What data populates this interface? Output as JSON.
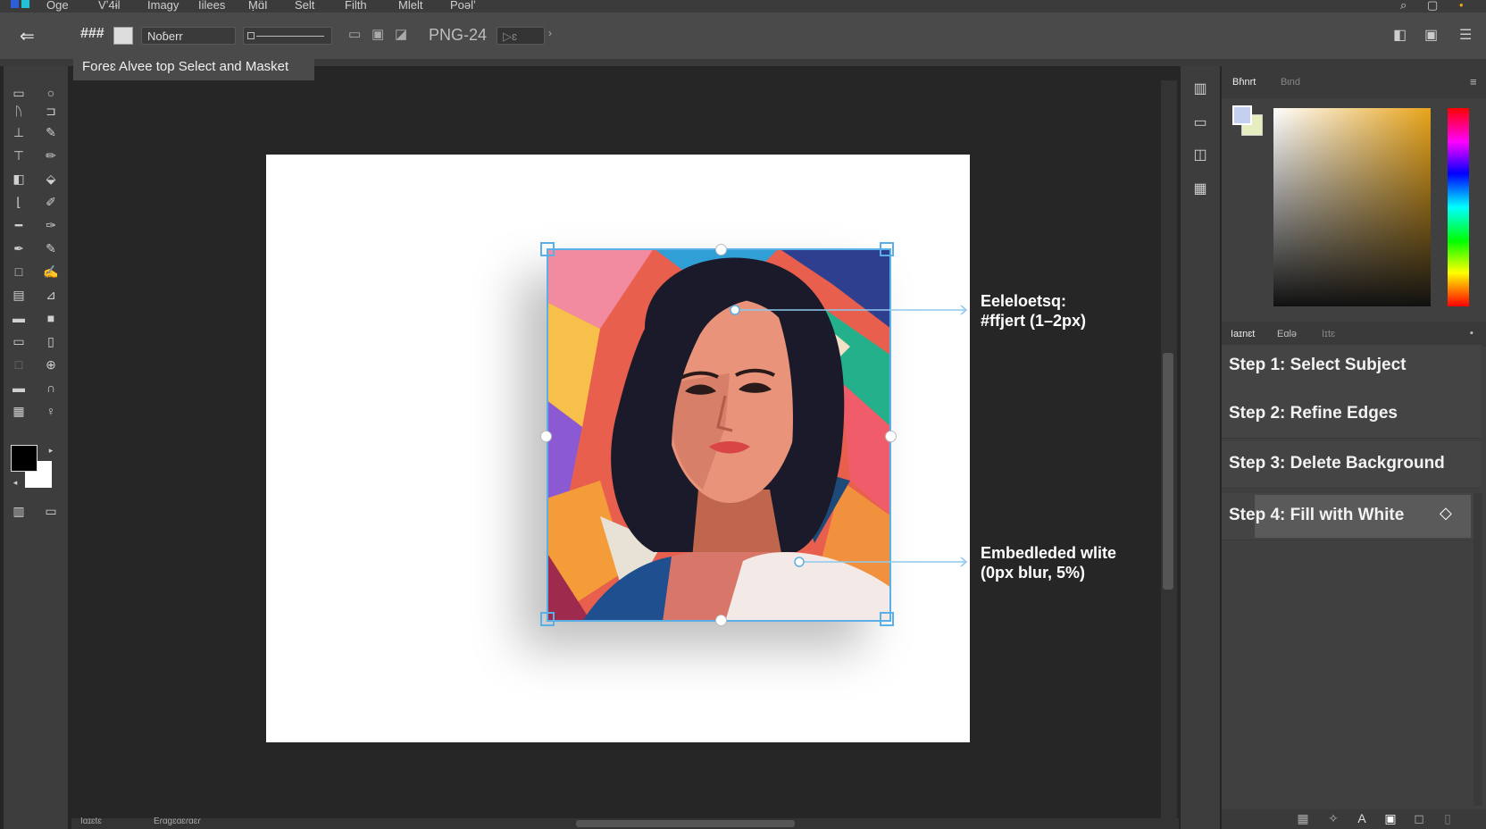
{
  "menu": {
    "items": [
      "Oɡe",
      "Vʼ4ɨl",
      "Imagy",
      "Iilees",
      "Ṃɑ̈I",
      "Selt",
      "Filth",
      "Mlelt",
      "Poəlʼ"
    ]
  },
  "options_bar": {
    "grid_icon_label": "###",
    "preset_value": "Noɓerr",
    "format_label": "PNG-24",
    "small_field_label": "▷ɛ"
  },
  "document_tab": {
    "title": "Foɾeɛ Alvee top Select and Masket"
  },
  "annotations": {
    "top_line1": "Eeleloetsq:",
    "top_line2": "#ffjert (1–2px)",
    "bottom_line1": "Embedleded wlite",
    "bottom_line2": "(0px blur, 5%)"
  },
  "color_panel": {
    "tabs": [
      "Bɦnrt",
      "Bɩnd"
    ],
    "foreground": "#000000",
    "background": "#ffffff",
    "accent": "#e8a41a"
  },
  "steps_panel": {
    "tabs": [
      "Iaɪnɛt",
      "Eɑlə",
      "Iɪtɛ"
    ],
    "steps": [
      {
        "label": "Step 1: Select Subject"
      },
      {
        "label": "Step 2: Refine Edges"
      },
      {
        "label": "Step 3: Delete Background"
      },
      {
        "label": "Step 4: Fill with White"
      }
    ],
    "active_step": 4
  },
  "status_bar": {
    "left_text": "Iɑɪɛtɛ",
    "mid_text": "Eɾɑɡɛɑɛɾɑɛɾ"
  },
  "colors": {
    "selection_blue": "#5ab0e6",
    "active_row": "#5a5a5a"
  }
}
